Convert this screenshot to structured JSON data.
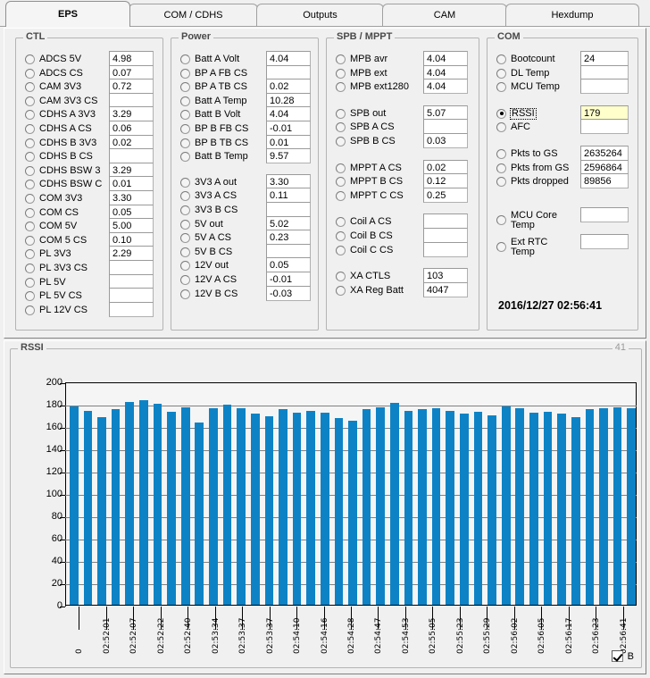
{
  "window": {
    "tabs": [
      {
        "label": "EPS",
        "active": true
      },
      {
        "label": "COM / CDHS",
        "active": false
      },
      {
        "label": "Outputs",
        "active": false
      },
      {
        "label": "CAM",
        "active": false
      },
      {
        "label": "Hexdump",
        "active": false
      }
    ]
  },
  "groups": {
    "ctl": {
      "title": "CTL",
      "rows": [
        {
          "label": "ADCS 5V",
          "value": "4.98",
          "selected": false
        },
        {
          "label": "ADCS CS",
          "value": "0.07",
          "selected": false
        },
        {
          "label": "CAM 3V3",
          "value": "0.72",
          "selected": false
        },
        {
          "label": "CAM 3V3 CS",
          "value": "",
          "selected": false
        },
        {
          "label": "CDHS A 3V3",
          "value": "3.29",
          "selected": false
        },
        {
          "label": "CDHS A CS",
          "value": "0.06",
          "selected": false
        },
        {
          "label": "CDHS B 3V3",
          "value": "0.02",
          "selected": false
        },
        {
          "label": "CDHS B CS",
          "value": "",
          "selected": false
        },
        {
          "label": "CDHS BSW 3",
          "value": "3.29",
          "selected": false
        },
        {
          "label": "CDHS BSW C",
          "value": "0.01",
          "selected": false
        },
        {
          "label": "COM 3V3",
          "value": "3.30",
          "selected": false
        },
        {
          "label": "COM CS",
          "value": "0.05",
          "selected": false
        },
        {
          "label": "COM 5V",
          "value": "5.00",
          "selected": false
        },
        {
          "label": "COM 5 CS",
          "value": "0.10",
          "selected": false
        },
        {
          "label": "PL 3V3",
          "value": "2.29",
          "selected": false
        },
        {
          "label": "PL 3V3 CS",
          "value": "",
          "selected": false
        },
        {
          "label": "PL 5V",
          "value": "",
          "selected": false
        },
        {
          "label": "PL 5V CS",
          "value": "",
          "selected": false
        },
        {
          "label": "PL 12V CS",
          "value": "",
          "selected": false
        }
      ]
    },
    "power": {
      "title": "Power",
      "groupA": [
        {
          "label": "Batt A Volt",
          "value": "4.04",
          "selected": false
        },
        {
          "label": "BP A FB CS",
          "value": "",
          "selected": false
        },
        {
          "label": "BP A TB CS",
          "value": "0.02",
          "selected": false
        },
        {
          "label": "Batt A Temp",
          "value": "10.28",
          "selected": false
        },
        {
          "label": "Batt B Volt",
          "value": "4.04",
          "selected": false
        },
        {
          "label": "BP B FB CS",
          "value": "-0.01",
          "selected": false
        },
        {
          "label": "BP B TB CS",
          "value": "0.01",
          "selected": false
        },
        {
          "label": "Batt B Temp",
          "value": "9.57",
          "selected": false
        }
      ],
      "groupB": [
        {
          "label": "3V3 A out",
          "value": "3.30",
          "selected": false
        },
        {
          "label": "3V3 A CS",
          "value": "0.11",
          "selected": false
        },
        {
          "label": "3V3 B CS",
          "value": "",
          "selected": false
        },
        {
          "label": "5V out",
          "value": "5.02",
          "selected": false
        },
        {
          "label": "5V A CS",
          "value": "0.23",
          "selected": false
        },
        {
          "label": "5V B CS",
          "value": "",
          "selected": false
        },
        {
          "label": "12V out",
          "value": "0.05",
          "selected": false
        },
        {
          "label": "12V A CS",
          "value": "-0.01",
          "selected": false
        },
        {
          "label": "12V B CS",
          "value": "-0.03",
          "selected": false
        }
      ]
    },
    "spb": {
      "title": "SPB / MPPT",
      "mpb": [
        {
          "label": "MPB avr",
          "value": "4.04",
          "selected": false
        },
        {
          "label": "MPB ext",
          "value": "4.04",
          "selected": false
        },
        {
          "label": "MPB ext1280",
          "value": "4.04",
          "selected": false
        }
      ],
      "spbOut": [
        {
          "label": "SPB out",
          "value": "5.07",
          "selected": false
        },
        {
          "label": "SPB A CS",
          "value": "",
          "selected": false
        },
        {
          "label": "SPB B CS",
          "value": "0.03",
          "selected": false
        }
      ],
      "mppt": [
        {
          "label": "MPPT A CS",
          "value": "0.02",
          "selected": false
        },
        {
          "label": "MPPT B CS",
          "value": "0.12",
          "selected": false
        },
        {
          "label": "MPPT C CS",
          "value": "0.25",
          "selected": false
        }
      ],
      "coil": [
        {
          "label": "Coil A CS",
          "value": "",
          "selected": false
        },
        {
          "label": "Coil B CS",
          "value": "",
          "selected": false
        },
        {
          "label": "Coil C CS",
          "value": "",
          "selected": false
        }
      ],
      "xa": [
        {
          "label": "XA CTLS",
          "value": "103",
          "selected": false
        },
        {
          "label": "XA Reg Batt",
          "value": "4047",
          "selected": false
        }
      ]
    },
    "com": {
      "title": "COM",
      "boot": [
        {
          "label": "Bootcount",
          "value": "24",
          "selected": false
        },
        {
          "label": "DL Temp",
          "value": "",
          "selected": false
        },
        {
          "label": "MCU Temp",
          "value": "",
          "selected": false
        }
      ],
      "signal": [
        {
          "label": "RSSI",
          "value": "179",
          "selected": true,
          "highlight": true,
          "focused": true
        },
        {
          "label": "AFC",
          "value": "",
          "selected": false,
          "highlight": false,
          "focused": false
        }
      ],
      "pkts": [
        {
          "label": "Pkts to GS",
          "value": "2635264",
          "selected": false
        },
        {
          "label": "Pkts from GS",
          "value": "2596864",
          "selected": false
        },
        {
          "label": "Pkts dropped",
          "value": "89856",
          "selected": false
        }
      ],
      "temps": [
        {
          "label": "MCU Core Temp",
          "value": "",
          "selected": false
        },
        {
          "label": "Ext RTC Temp",
          "value": "",
          "selected": false
        }
      ],
      "timestamp": "2016/12/27 02:56:41"
    },
    "rssi_plot": {
      "title": "RSSI",
      "count": "41",
      "legend_checkbox": {
        "label": "B",
        "checked": true
      }
    }
  },
  "chart_data": {
    "type": "bar",
    "title": "RSSI",
    "xlabel": "",
    "ylabel": "",
    "ylim": [
      0,
      200
    ],
    "ytick_step": 20,
    "yticks": [
      0,
      20,
      40,
      60,
      80,
      100,
      120,
      140,
      160,
      180,
      200
    ],
    "grid": true,
    "series_name": "B",
    "bar_color": "#0d83c6",
    "x_tick_labels": [
      "0",
      "02:52:01",
      "02:52:07",
      "02:52:22",
      "02:52:40",
      "02:53:34",
      "02:53:37",
      "02:53:37",
      "02:54:10",
      "02:54:16",
      "02:54:28",
      "02:54:47",
      "02:54:53",
      "02:55:05",
      "02:55:23",
      "02:55:29",
      "02:56:02",
      "02:56:05",
      "02:56:17",
      "02:56:23",
      "02:56:41"
    ],
    "values": [
      178,
      174,
      168,
      175,
      182,
      183,
      180,
      173,
      177,
      163,
      176,
      179,
      176,
      171,
      169,
      175,
      172,
      174,
      172,
      167,
      165,
      175,
      177,
      181,
      174,
      175,
      176,
      174,
      171,
      173,
      170,
      178,
      176,
      172,
      173,
      171,
      168,
      175,
      176,
      177,
      176
    ]
  }
}
